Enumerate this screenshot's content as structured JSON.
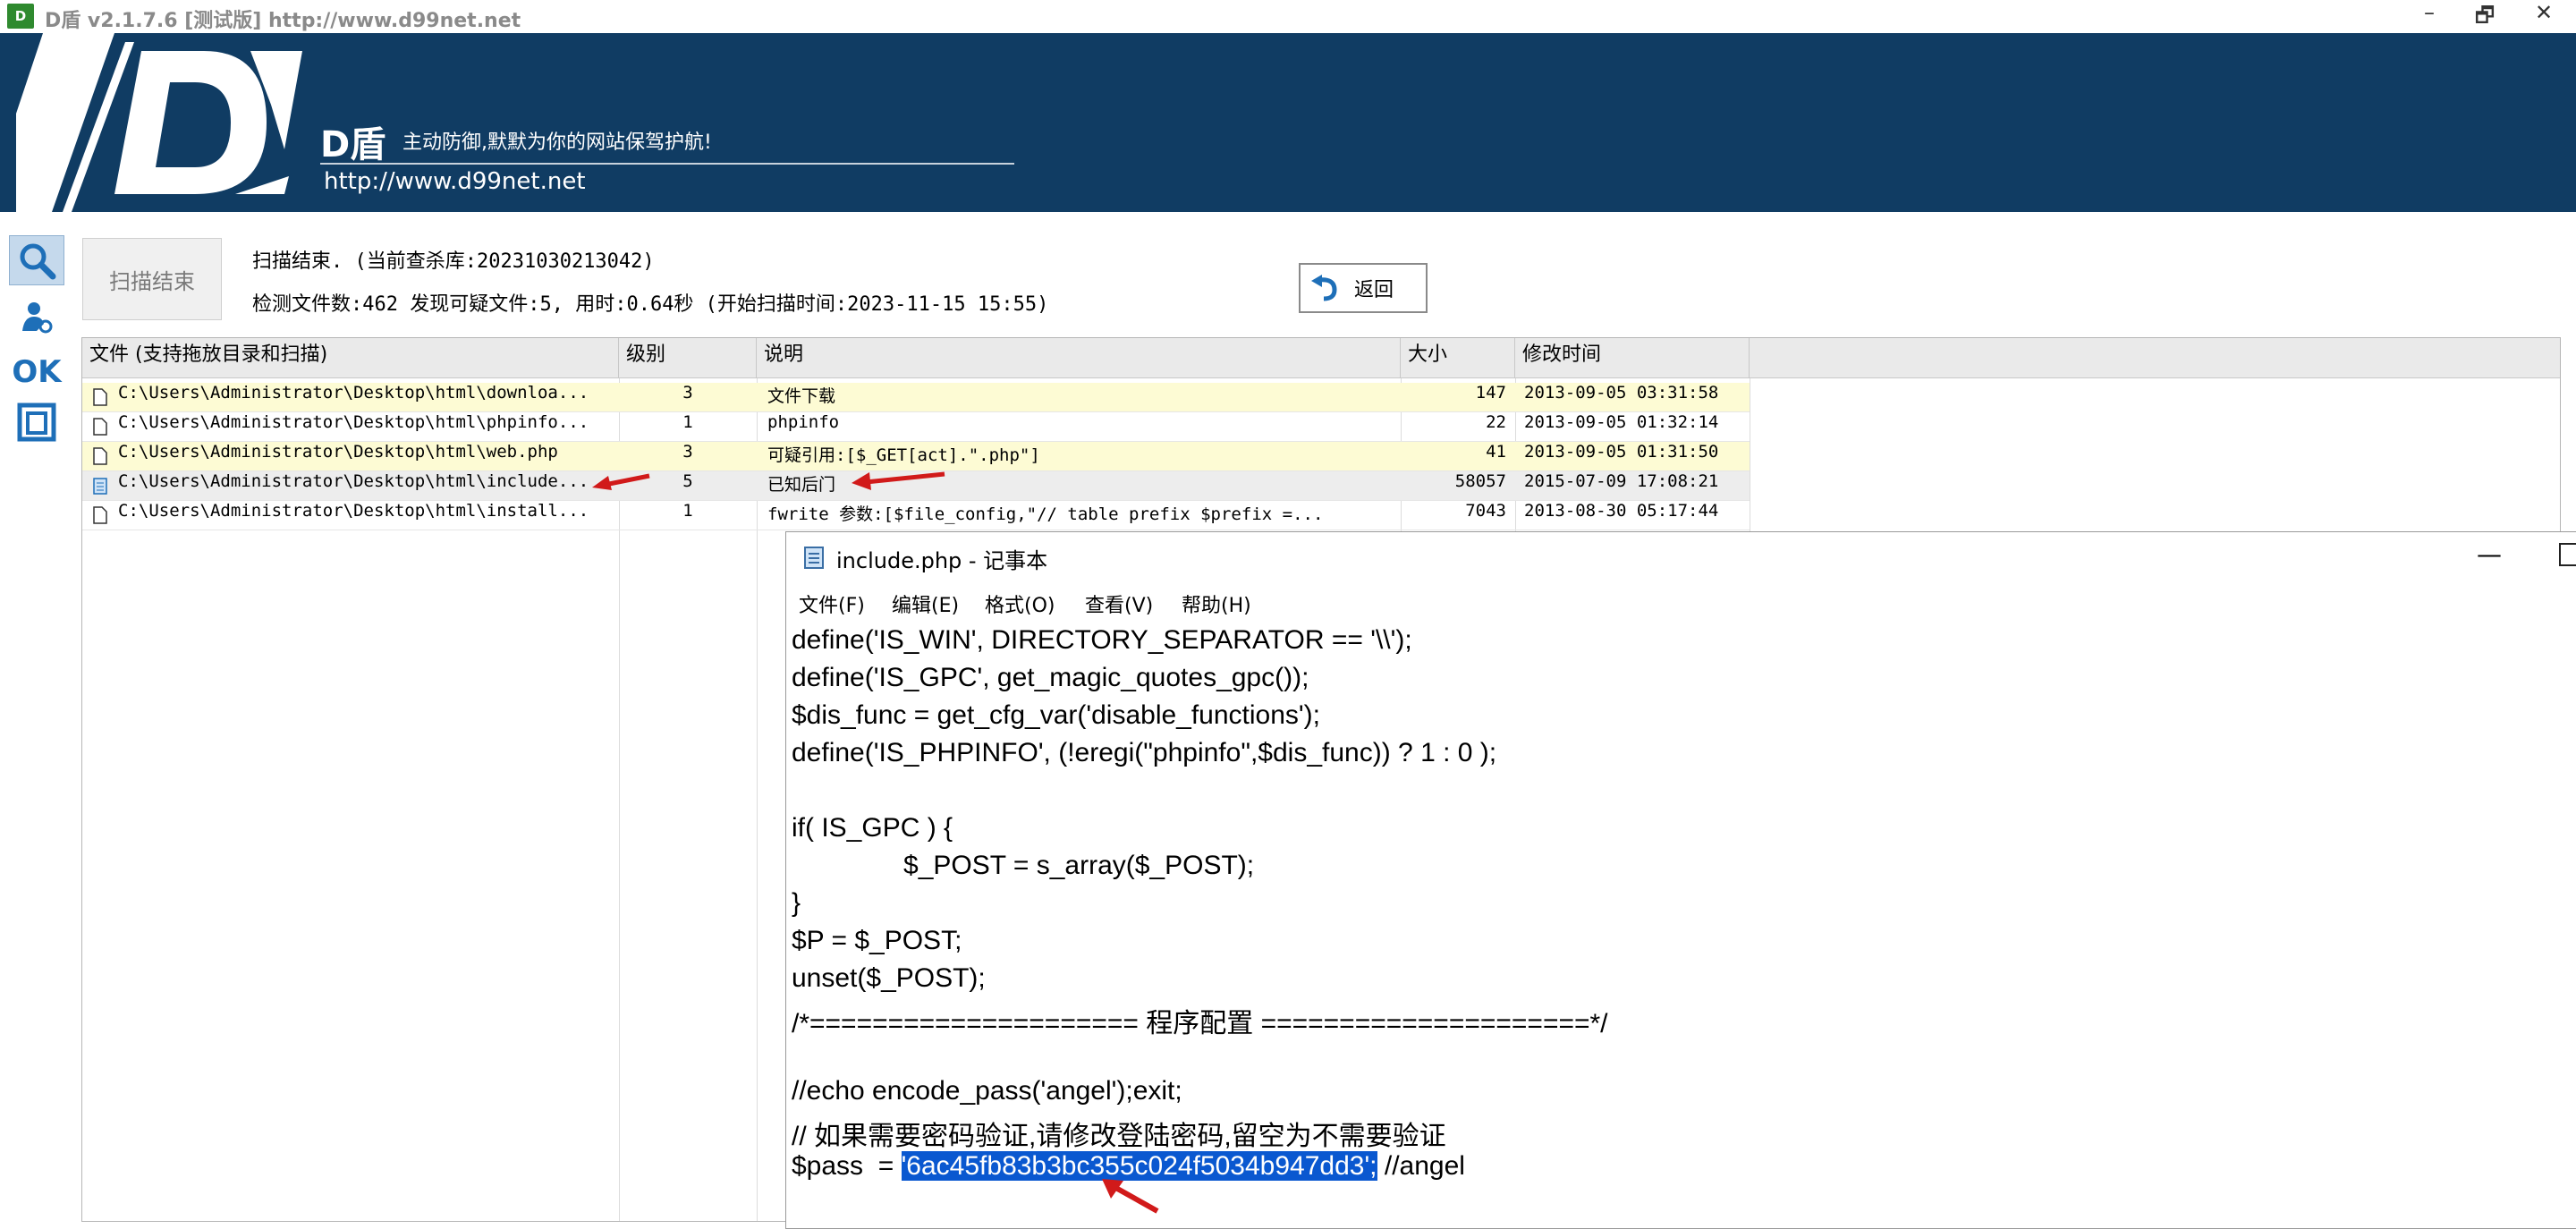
{
  "titlebar": {
    "app_icon_text": "D",
    "title": "D盾 v2.1.7.6 [测试版] http://www.d99net.net",
    "buttons": {
      "minimize": "–",
      "restore": "🗗",
      "close": "✕"
    }
  },
  "banner": {
    "logo_text": "D",
    "brand_name": "D盾",
    "slogan": "主动防御,默默为你的网站保驾护航!",
    "url": "http://www.d99net.net",
    "background_color": "#103c63"
  },
  "sidebar": {
    "items": [
      {
        "name": "search",
        "icon": "magnifier-icon"
      },
      {
        "name": "process",
        "icon": "user-gear-icon"
      },
      {
        "name": "ok",
        "label": "OK"
      },
      {
        "name": "window",
        "icon": "window-icon"
      }
    ]
  },
  "scan": {
    "end_button_label": "扫描结束",
    "status_line": "扫描结束. (当前查杀库:20231030213042)",
    "stats_line": "检测文件数:462 发现可疑文件:5, 用时:0.64秒 (开始扫描时间:2023-11-15 15:55)",
    "back_button_label": "返回"
  },
  "table": {
    "columns": [
      "文件 (支持拖放目录和扫描)",
      "级别",
      "说明",
      "大小",
      "修改时间"
    ],
    "rows": [
      {
        "file": "C:\\Users\\Administrator\\Desktop\\html\\downloa...",
        "level": "3",
        "desc": "文件下载",
        "size": "147",
        "time": "2013-09-05 03:31:58",
        "style": "highlight"
      },
      {
        "file": "C:\\Users\\Administrator\\Desktop\\html\\phpinfo...",
        "level": "1",
        "desc": "phpinfo",
        "size": "22",
        "time": "2013-09-05 01:32:14",
        "style": "normal"
      },
      {
        "file": "C:\\Users\\Administrator\\Desktop\\html\\web.php",
        "level": "3",
        "desc": "可疑引用:[$_GET[act].\".php\"]",
        "size": "41",
        "time": "2013-09-05 01:31:50",
        "style": "highlight"
      },
      {
        "file": "C:\\Users\\Administrator\\Desktop\\html\\include...",
        "level": "5",
        "desc": "已知后门",
        "size": "58057",
        "time": "2015-07-09 17:08:21",
        "style": "selected"
      },
      {
        "file": "C:\\Users\\Administrator\\Desktop\\html\\install...",
        "level": "1",
        "desc": "fwrite 参数:[$file_config,\"// table prefix $prefix   =...",
        "size": "7043",
        "time": "2013-08-30 05:17:44",
        "style": "normal"
      }
    ]
  },
  "notepad": {
    "title": "include.php - 记事本",
    "min_label": "—",
    "menu": [
      "文件(F)",
      "编辑(E)",
      "格式(O)",
      "查看(V)",
      "帮助(H)"
    ],
    "lines": [
      "define('IS_WIN', DIRECTORY_SEPARATOR == '\\\\');",
      "define('IS_GPC', get_magic_quotes_gpc());",
      "$dis_func = get_cfg_var('disable_functions');",
      "define('IS_PHPINFO', (!eregi(\"phpinfo\",$dis_func)) ? 1 : 0 );",
      "",
      "if( IS_GPC ) {",
      "               $_POST = s_array($_POST);",
      "}",
      "$P = $_POST;",
      "unset($_POST);",
      "/*===================== 程序配置 =====================*/",
      "",
      "//echo encode_pass('angel');exit;",
      "// 如果需要密码验证,请修改登陆密码,留空为不需要验证"
    ],
    "pass_line": {
      "prefix": "$pass  = ",
      "selected": "'6ac45fb83b3bc355c024f5034b947dd3';",
      "suffix": " //angel"
    },
    "selection_color": "#0a58d0"
  }
}
